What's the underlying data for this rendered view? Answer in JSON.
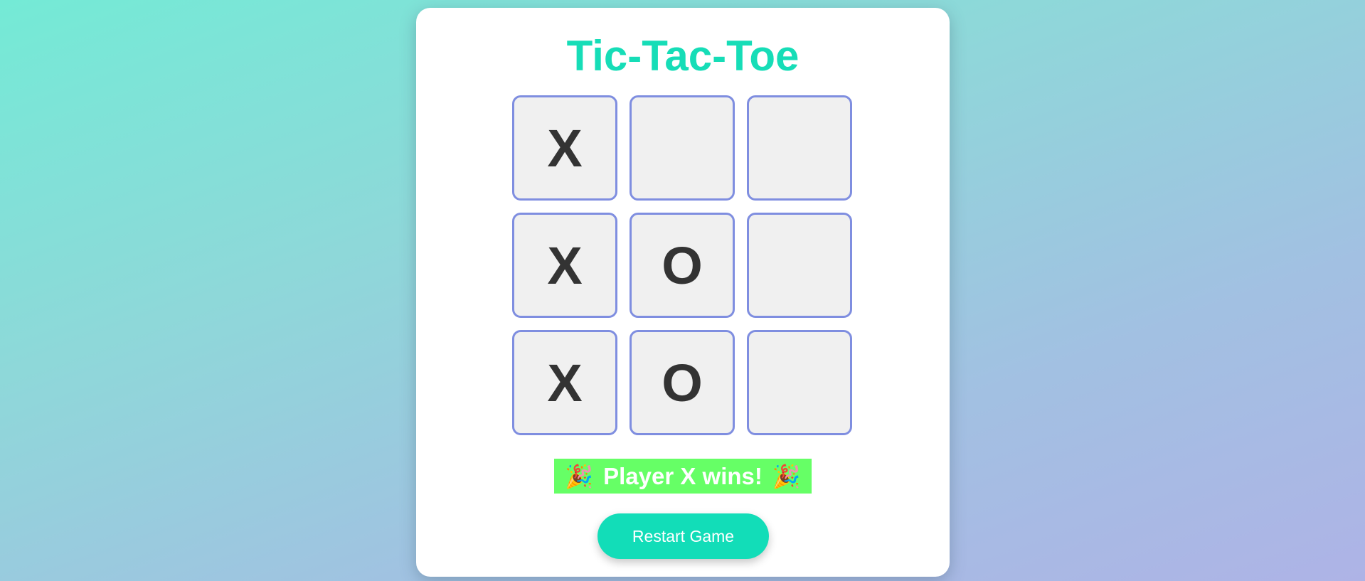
{
  "game": {
    "title": "Tic-Tac-Toe",
    "board": [
      [
        "X",
        "",
        ""
      ],
      [
        "X",
        "O",
        ""
      ],
      [
        "X",
        "O",
        ""
      ]
    ],
    "status": {
      "icon_left": "🎉",
      "text": "Player X wins!",
      "icon_right": "🎉",
      "icon_name": "party-popper-icon",
      "background_color": "#66ff66"
    },
    "restart_label": "Restart Game"
  },
  "colors": {
    "accent": "#16ddb7",
    "cell_border": "#7f8ee0",
    "cell_background": "#f0f0f0",
    "mark": "#333333"
  }
}
